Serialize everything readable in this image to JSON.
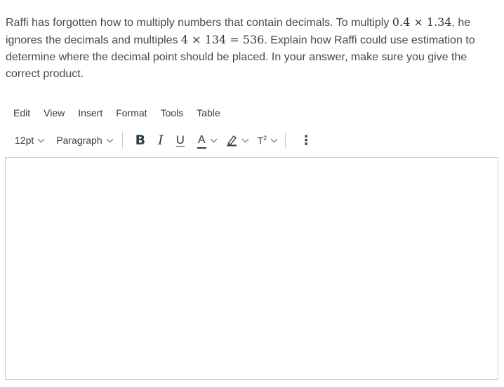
{
  "question": {
    "part1": "Raffi has forgotten how to multiply numbers that contain decimals. To multiply ",
    "math1": "0.4 × 1.34",
    "part2": ", he ignores the decimals and multiples ",
    "math2": "4 × 134 = 536",
    "part3": ". Explain how Raffi could use estimation to determine where the decimal point should be placed. In your answer, make sure you give the correct product."
  },
  "menubar": {
    "items": [
      "Edit",
      "View",
      "Insert",
      "Format",
      "Tools",
      "Table"
    ]
  },
  "toolbar": {
    "font_size": "12pt",
    "block_format": "Paragraph",
    "bold": "B",
    "italic": "I",
    "underline": "U",
    "text_color": "A",
    "superscript": "T",
    "superscript_mark": "2",
    "more": "⋮"
  },
  "editor": {
    "content": ""
  },
  "colors": {
    "text": "#494949",
    "toolbar_text": "#2d3b45",
    "border": "#c7cdd1"
  }
}
